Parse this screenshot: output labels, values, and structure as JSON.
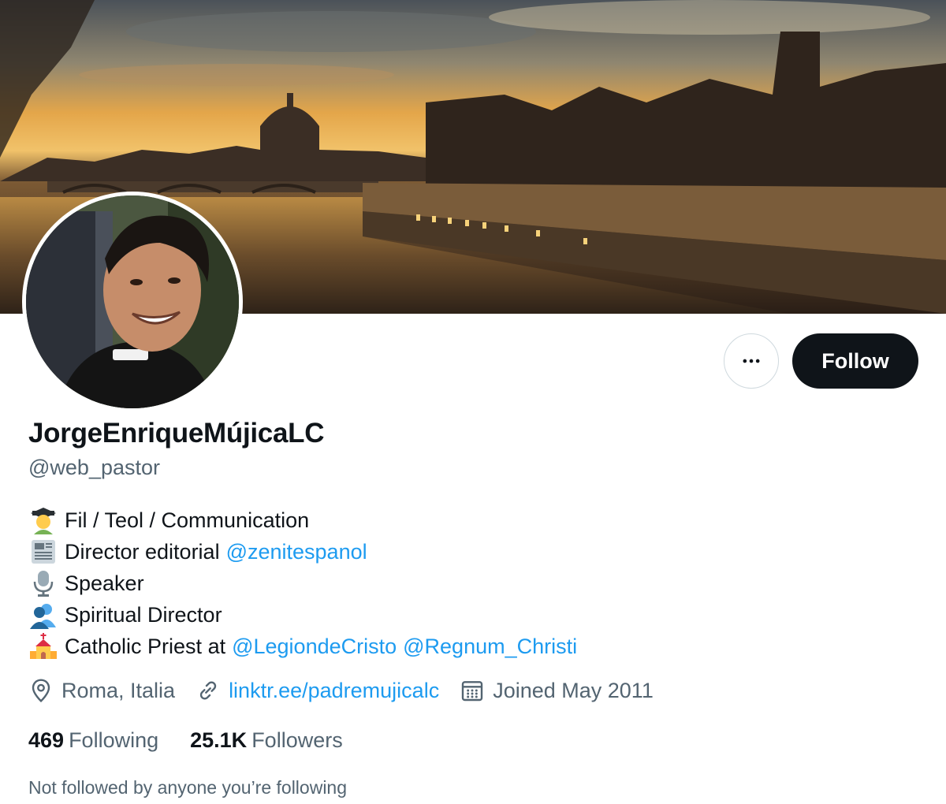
{
  "profile": {
    "display_name": "JorgeEnriqueMújicaLC",
    "handle": "@web_pastor",
    "follow_label": "Follow",
    "more_label": "More"
  },
  "bio": {
    "line1": {
      "emoji": "student-icon",
      "text": "Fil / Teol / Communication"
    },
    "line2": {
      "emoji": "newspaper-icon",
      "text": "Director editorial",
      "mention": "@zenitespanol"
    },
    "line3": {
      "emoji": "microphone-icon",
      "text": "Speaker"
    },
    "line4": {
      "emoji": "people-icon",
      "text": "Spiritual Director"
    },
    "line5": {
      "emoji": "church-icon",
      "text": "Catholic Priest at",
      "mention1": "@LegiondeCristo",
      "mention2": "@Regnum_Christi"
    }
  },
  "meta": {
    "location": "Roma, Italia",
    "website": "linktr.ee/padremujicalc",
    "joined": "Joined May 2011"
  },
  "stats": {
    "following_count": "469",
    "following_label": "Following",
    "followers_count": "25.1K",
    "followers_label": "Followers"
  },
  "followed_by_text": "Not followed by anyone you’re following",
  "colors": {
    "accent": "#1d9bf0",
    "text": "#0f1419",
    "secondary": "#536471",
    "button_dark": "#0f1419"
  }
}
